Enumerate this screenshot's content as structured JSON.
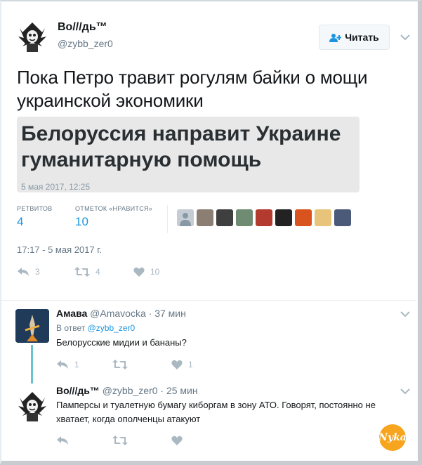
{
  "main_tweet": {
    "author_name": "Во///дь™",
    "author_handle": "@zybb_zer0",
    "follow_label": "Читать",
    "text": "Пока Петро травит рогулям байки о мощи украинской экономики",
    "quote": {
      "title": "Белоруссия направит Украине гуманитарную помощь",
      "date": "5 мая 2017, 12:25"
    },
    "stats": {
      "retweets_label": "РЕТВИТОВ",
      "retweets_value": "4",
      "likes_label": "ОТМЕТОК «НРАВИТСЯ»",
      "likes_value": "10"
    },
    "timestamp": "17:17 - 5 мая 2017 г.",
    "actions": {
      "reply_count": "3",
      "retweet_count": "4",
      "like_count": "10"
    }
  },
  "replies": [
    {
      "author_name": "Амава",
      "author_handle": "@Amavocka",
      "time": "· 37 мин",
      "reply_to_prefix": "В ответ",
      "reply_to_handle": "@zybb_zer0",
      "text": "Белорусские мидии и бананы?",
      "reply_count": "1",
      "retweet_count": "",
      "like_count": "1"
    },
    {
      "author_name": "Во///дь™",
      "author_handle": "@zybb_zer0",
      "time": "· 25 мин",
      "text_line1": "Памперсы и туалетную бумагу киборгам в зону АТО. Говорят, постоянно не",
      "text_line2": "хватает, когда ополченцы атакуют",
      "reply_count": "",
      "retweet_count": "",
      "like_count": ""
    }
  ],
  "watermark": "Nyka",
  "colors": {
    "link_blue": "#1b95e0",
    "muted": "#657786",
    "icon_gray": "#aab8c2",
    "thread_line": "#66c4cf",
    "badge_orange": "#f7a51f"
  }
}
